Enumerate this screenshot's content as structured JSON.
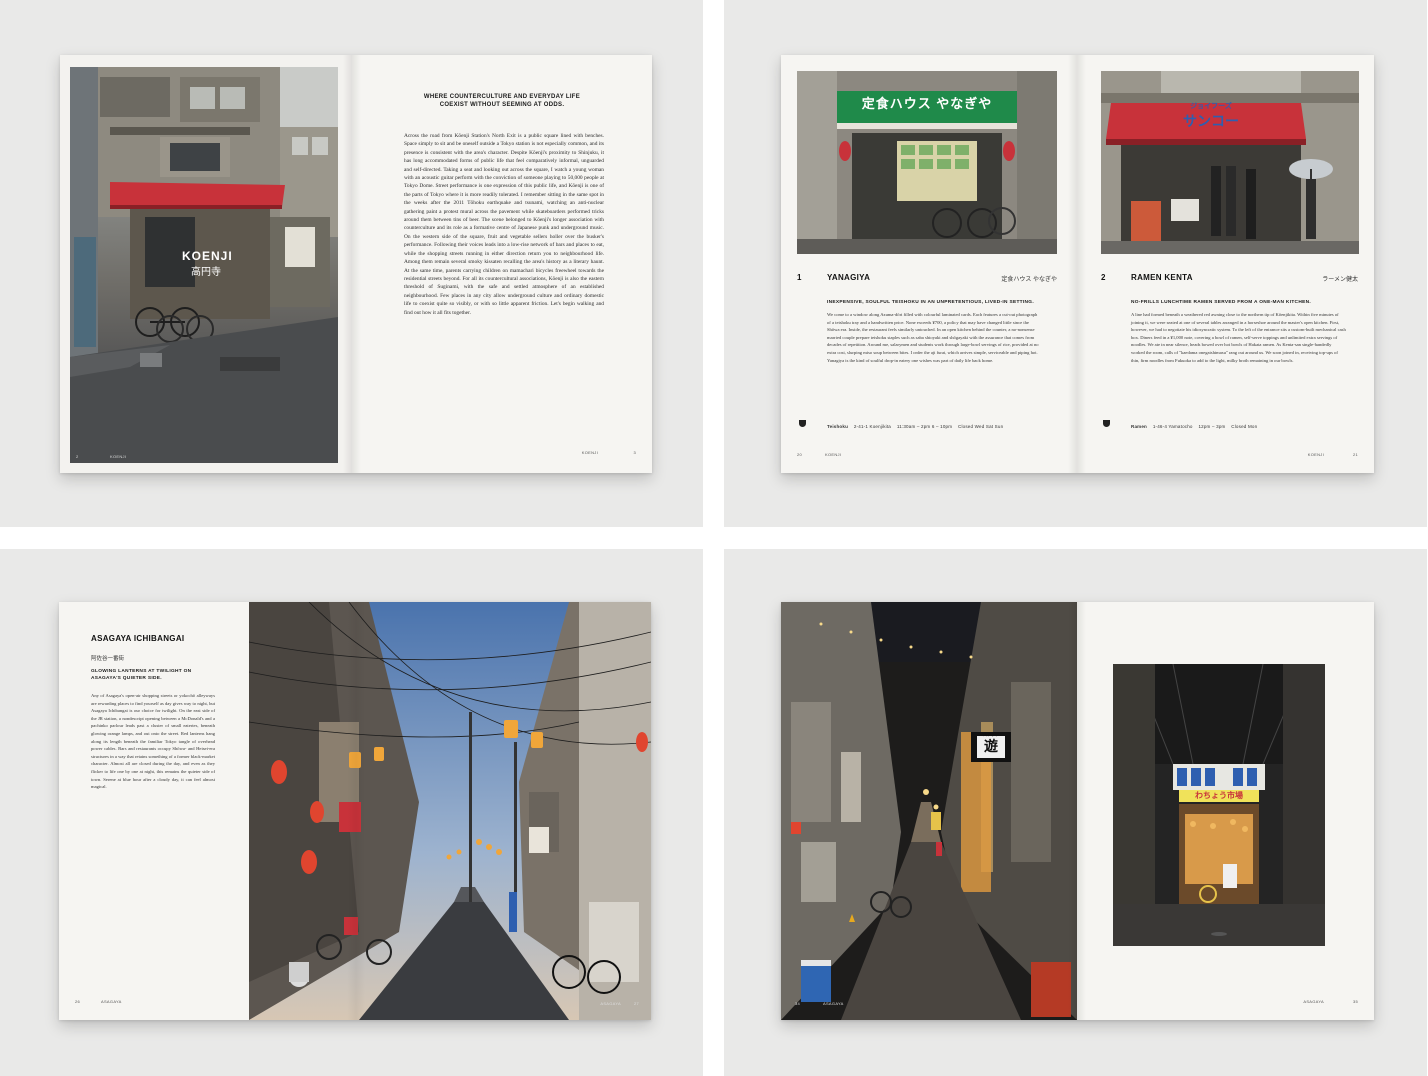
{
  "spread1": {
    "photo_sign_title": "KOENJI",
    "photo_sign_jp": "高円寺",
    "heading": "WHERE COUNTERCULTURE AND EVERYDAY LIFE COEXIST WITHOUT SEEMING AT ODDS.",
    "body": "Across the road from Kōenji Station's North Exit is a public square lined with benches. Space simply to sit and be oneself outside a Tokyo station is not especially common, and its presence is consistent with the area's character. Despite Kōenji's proximity to Shinjuku, it has long accommodated forms of public life that feel comparatively informal, unguarded and self-directed. Taking a seat and looking out across the square, I watch a young woman with an acoustic guitar perform with the conviction of someone playing to 50,000 people at Tokyo Dome. Street performance is one expression of this public life, and Kōenji is one of the parts of Tokyo where it is more readily tolerated. I remember sitting in the same spot in the weeks after the 2011 Tōhoku earthquake and tsunami, watching an anti-nuclear gathering paint a protest mural across the pavement while skateboarders performed tricks around them between tins of beer. The scene belonged to Kōenji's longer association with counterculture and its role as a formative centre of Japanese punk and underground music. On the western side of the square, fruit and vegetable sellers holler over the busker's performance. Following their voices leads into a low-rise network of bars and places to eat, while the shopping streets running in either direction return you to neighbourhood life. Among them remain several smoky kissaten recalling the area's history as a literary haunt. At the same time, parents carrying children on mamachari bicycles freewheel towards the residential streets beyond. For all its countercultural associations, Kōenji is also the eastern threshold of Suginami, with the safe and settled atmosphere of an established neighbourhood. Few places in any city allow underground culture and ordinary domestic life to coexist quite so visibly, or with so little apparent friction. Let's begin walking and find out how it all fits together.",
    "folio_left_num": "2",
    "folio_left_label": "KOENJI",
    "folio_right_label": "KOENJI",
    "folio_right_num": "3"
  },
  "spread2": {
    "left_sign_jp": "定食ハウス やなぎや",
    "right_sign_jp_small": "ジョイフーズ",
    "right_sign_jp": "サンコー",
    "entry1": {
      "num": "1",
      "title": "YANAGIYA",
      "jp": "定食ハウス やなぎや",
      "lede": "INEXPENSIVE, SOULFUL TEISHOKU IN AN UNPRETENTIOUS, LIVED-IN SETTING.",
      "body": "We come to a window along Azuma-dōri filled with colourful laminated cards. Each features a cut-out photograph of a teishoku tray and a handwritten price. None exceeds ¥700, a policy that may have changed little since the Shōwa era. Inside, the restaurant feels similarly untouched. In an open kitchen behind the counter, a no-nonsense married couple prepare teishoku staples such as saba shioyaki and shōgayaki with the assurance that comes from decades of repetition. Around me, salarymen and students work through large-bowl servings of rice, provided at no extra cost, slurping miso soup between bites. I order the aji furai, which arrives simple, serviceable and piping hot. Yanagiya is the kind of soulful drop-in eatery one wishes was part of daily life back home.",
      "info_type": "Teishoku",
      "info_addr": "2-41-1 Koenjikita",
      "info_hours": "11:30am – 2pm  6 – 10pm",
      "info_closed": "Closed Wed Sat Sun"
    },
    "entry2": {
      "num": "2",
      "title": "RAMEN KENTA",
      "jp": "ラーメン健太",
      "lede": "NO-FRILLS LUNCHTIME RAMEN SERVED FROM A ONE-MAN KITCHEN.",
      "body": "A line had formed beneath a weathered red awning close to the northern tip of Kōenjikita. Within five minutes of joining it, we were seated at one of several tables arranged in a horseshoe around the master's open kitchen. First, however, we had to negotiate his idiosyncratic system. To the left of the entrance sits a custom-built mechanical cash box. Diners feed in a ¥1,000 note, covering a bowl of ramen, self-serve toppings and unlimited extra servings of noodles. We ate in near silence, heads bowed over hot bowls of Hakata ramen. As Kenta-san single-handedly worked the room, calls of \"kaedama onegaishimasu\" rang out around us. We soon joined in, receiving top-ups of thin, firm noodles from Fukuoka to add to the light, milky broth remaining in our bowls.",
      "info_type": "Ramen",
      "info_addr": "1-46-4 Yamatocho",
      "info_hours": "12pm – 3pm",
      "info_closed": "Closed Mon"
    },
    "folio_left_num": "20",
    "folio_left_label": "KOENJI",
    "folio_right_label": "KOENJI",
    "folio_right_num": "21"
  },
  "spread3": {
    "title": "ASAGAYA ICHIBANGAI",
    "jp": "阿佐谷一番街",
    "lede": "GLOWING LANTERNS AT TWILIGHT ON ASAGAYA'S QUIETER SIDE.",
    "body": "Any of Asagaya's open-air shopping streets or yokochō alleyways are rewarding places to find yourself as day gives way to night, but Asagaya Ichibangai is our choice for twilight. On the east side of the JR station, a nondescript opening between a McDonald's and a pachinko parlour leads past a cluster of small eateries, beneath glowing orange lamps, and out onto the street. Red lanterns hang along its length beneath the familiar Tokyo tangle of overhead power cables. Bars and restaurants occupy Shōwa- and Heisei-era structures in a way that retains something of a former black-market character. Almost all are closed during the day, and even as they flicker to life one by one at night, this remains the quieter side of town. Serene at blue hour after a cloudy day, it can feel almost magical.",
    "folio_left_num": "26",
    "folio_left_label": "ASAGAYA",
    "folio_right_label": "ASAGAYA",
    "folio_right_num": "27"
  },
  "spread4": {
    "sign_jp_small": "スナック",
    "sign_jp": "遊",
    "inset_sign_jp": "わちょう市場",
    "folio_left_num": "34",
    "folio_left_label": "ASAGAYA",
    "folio_right_label": "ASAGAYA",
    "folio_right_num": "35"
  },
  "colors": {
    "awning_red": "#c8323a",
    "sign_green": "#1f8a4a",
    "lantern_amber": "#f0a63a",
    "twilight_sky": "#5f86b8",
    "paper": "#f6f5f2",
    "backdrop": "#e9e9e8"
  }
}
